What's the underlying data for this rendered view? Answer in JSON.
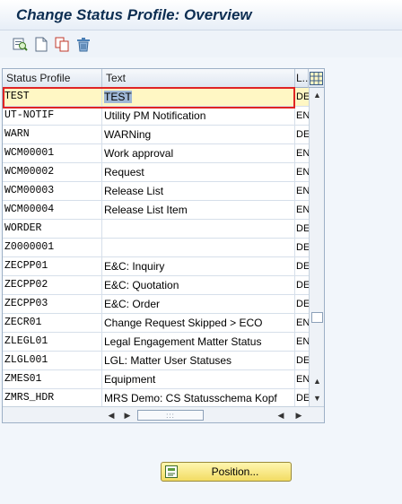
{
  "window": {
    "title": "Change Status Profile: Overview"
  },
  "toolbar": {
    "buttons": [
      {
        "name": "detail-icon"
      },
      {
        "name": "new-entries-icon"
      },
      {
        "name": "copy-as-icon"
      },
      {
        "name": "delete-icon"
      }
    ]
  },
  "table": {
    "columns": [
      "Status Profile",
      "Text",
      "L.."
    ],
    "rows": [
      {
        "profile": "TEST",
        "text": "TEST",
        "lang": "DE"
      },
      {
        "profile": "UT-NOTIF",
        "text": "Utility PM Notification",
        "lang": "EN"
      },
      {
        "profile": "WARN",
        "text": "WARNing",
        "lang": "DE"
      },
      {
        "profile": "WCM00001",
        "text": "Work approval",
        "lang": "EN"
      },
      {
        "profile": "WCM00002",
        "text": "Request",
        "lang": "EN"
      },
      {
        "profile": "WCM00003",
        "text": "Release List",
        "lang": "EN"
      },
      {
        "profile": "WCM00004",
        "text": "Release List Item",
        "lang": "EN"
      },
      {
        "profile": "WORDER",
        "text": "",
        "lang": "DE"
      },
      {
        "profile": "Z0000001",
        "text": "",
        "lang": "DE"
      },
      {
        "profile": "ZECPP01",
        "text": "E&C: Inquiry",
        "lang": "DE"
      },
      {
        "profile": "ZECPP02",
        "text": "E&C: Quotation",
        "lang": "DE"
      },
      {
        "profile": "ZECPP03",
        "text": "E&C: Order",
        "lang": "DE"
      },
      {
        "profile": "ZECR01",
        "text": "Change Request Skipped > ECO",
        "lang": "EN"
      },
      {
        "profile": "ZLEGL01",
        "text": "Legal Engagement Matter Status",
        "lang": "EN"
      },
      {
        "profile": "ZLGL001",
        "text": "LGL: Matter User Statuses",
        "lang": "DE"
      },
      {
        "profile": "ZMES01",
        "text": "Equipment",
        "lang": "EN"
      },
      {
        "profile": "ZMRS_HDR",
        "text": "MRS Demo: CS Statusschema Kopf",
        "lang": "DE"
      }
    ],
    "selected_index": 0,
    "column_settings_icon": "table-settings-icon"
  },
  "position_button": {
    "label": "Position...",
    "icon": "position-icon"
  }
}
